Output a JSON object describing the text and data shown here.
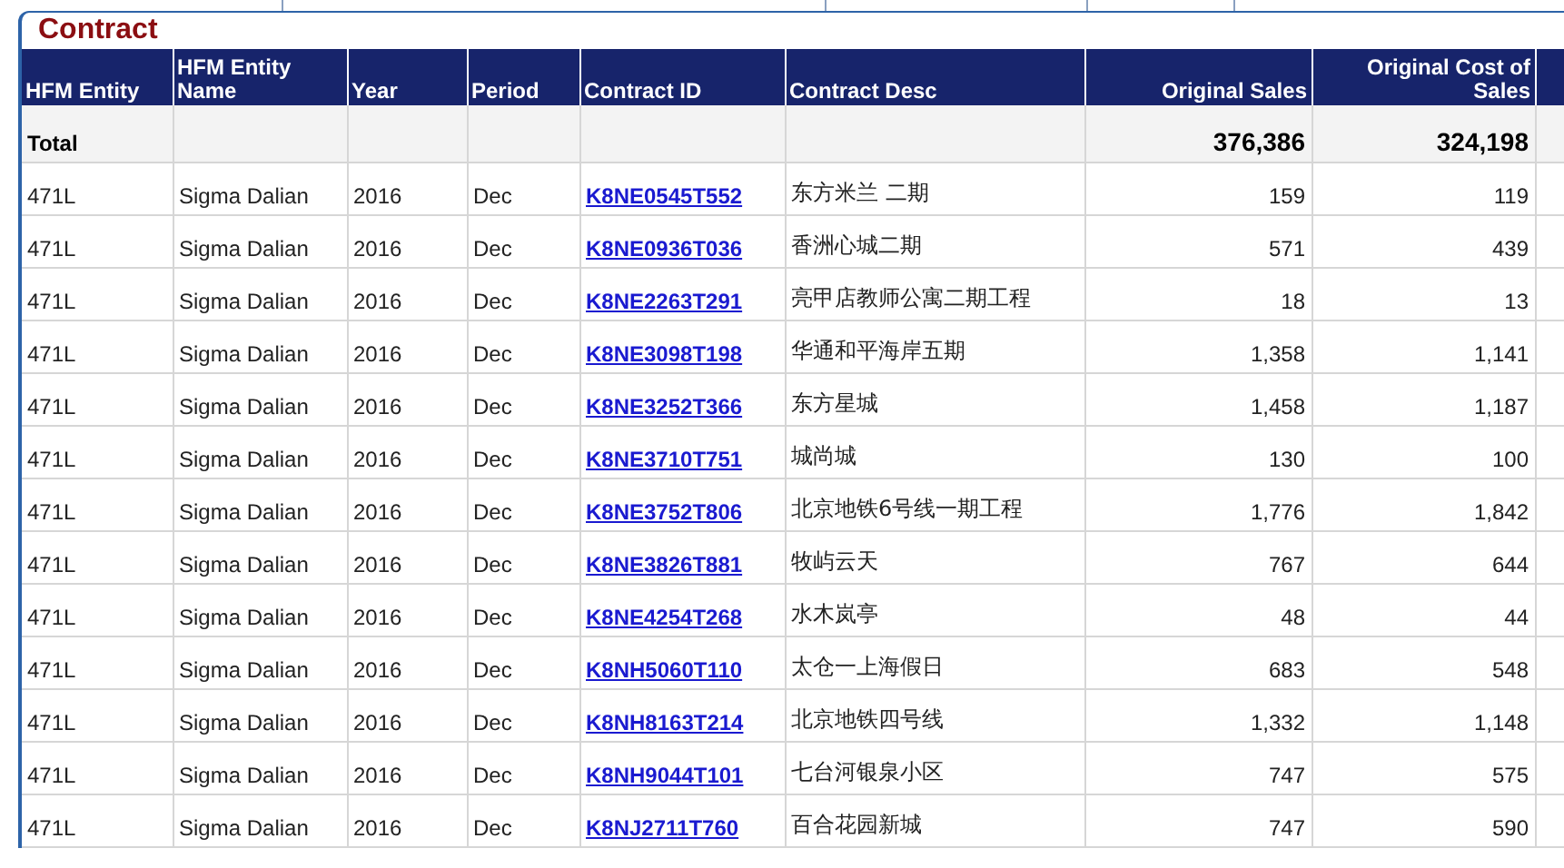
{
  "panel": {
    "title": "Contract"
  },
  "table": {
    "columns": [
      {
        "label": "HFM Entity",
        "kind": "text"
      },
      {
        "label": "HFM Entity Name",
        "kind": "text"
      },
      {
        "label": "Year",
        "kind": "text"
      },
      {
        "label": "Period",
        "kind": "text"
      },
      {
        "label": "Contract ID",
        "kind": "link"
      },
      {
        "label": "Contract Desc",
        "kind": "text"
      },
      {
        "label": "Original Sales",
        "kind": "number"
      },
      {
        "label": "Original Cost of Sales",
        "kind": "number"
      }
    ],
    "total": {
      "label": "Total",
      "original_sales": "376,386",
      "original_cost_of_sales": "324,198"
    },
    "rows": [
      [
        "471L",
        "Sigma Dalian",
        "2016",
        "Dec",
        "K8NE0545T552",
        "东方米兰 二期",
        "159",
        "119"
      ],
      [
        "471L",
        "Sigma Dalian",
        "2016",
        "Dec",
        "K8NE0936T036",
        "香洲心城二期",
        "571",
        "439"
      ],
      [
        "471L",
        "Sigma Dalian",
        "2016",
        "Dec",
        "K8NE2263T291",
        "亮甲店教师公寓二期工程",
        "18",
        "13"
      ],
      [
        "471L",
        "Sigma Dalian",
        "2016",
        "Dec",
        "K8NE3098T198",
        "华通和平海岸五期",
        "1,358",
        "1,141"
      ],
      [
        "471L",
        "Sigma Dalian",
        "2016",
        "Dec",
        "K8NE3252T366",
        "东方星城",
        "1,458",
        "1,187"
      ],
      [
        "471L",
        "Sigma Dalian",
        "2016",
        "Dec",
        "K8NE3710T751",
        "城尚城",
        "130",
        "100"
      ],
      [
        "471L",
        "Sigma Dalian",
        "2016",
        "Dec",
        "K8NE3752T806",
        "北京地铁6号线一期工程",
        "1,776",
        "1,842"
      ],
      [
        "471L",
        "Sigma Dalian",
        "2016",
        "Dec",
        "K8NE3826T881",
        "牧屿云天",
        "767",
        "644"
      ],
      [
        "471L",
        "Sigma Dalian",
        "2016",
        "Dec",
        "K8NE4254T268",
        "水木岚亭",
        "48",
        "44"
      ],
      [
        "471L",
        "Sigma Dalian",
        "2016",
        "Dec",
        "K8NH5060T110",
        "太仓一上海假日",
        "683",
        "548"
      ],
      [
        "471L",
        "Sigma Dalian",
        "2016",
        "Dec",
        "K8NH8163T214",
        "北京地铁四号线",
        "1,332",
        "1,148"
      ],
      [
        "471L",
        "Sigma Dalian",
        "2016",
        "Dec",
        "K8NH9044T101",
        "七台河银泉小区",
        "747",
        "575"
      ],
      [
        "471L",
        "Sigma Dalian",
        "2016",
        "Dec",
        "K8NJ2711T760",
        "百合花园新城",
        "747",
        "590"
      ]
    ]
  }
}
